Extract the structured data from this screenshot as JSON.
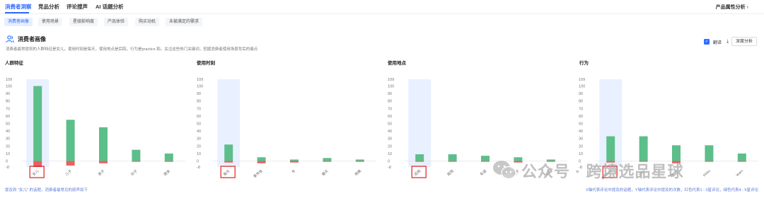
{
  "nav": {
    "tabs": [
      "消费者洞察",
      "竞品分析",
      "评论搜声",
      "AI 话题分析"
    ],
    "right_label": "产品属性分析"
  },
  "subtabs": [
    "消费者画像",
    "使用场景",
    "星级影响度",
    "产品体验",
    "购买动机",
    "未被满足的需求"
  ],
  "section": {
    "title": "消费者画像",
    "desc": "消费者最常提到的人群特征是女儿，使用时刻是每天，使用地点是后院，行为是practice 和。关注这些热门关键词，挖掘消费者使用场景背后的痛点"
  },
  "actions": {
    "translate_label": "翻译",
    "translate_checked": true,
    "deep_label": "深度分析"
  },
  "footer": {
    "left": "提及到 \"女儿\" 的话题，消费者最常见的原声如下",
    "right": "X轴代表评论中提及的话题，Y轴代表评论中提及的次数，红色代表1 - 3星评论，绿色代表4 - 5星评论"
  },
  "watermark": {
    "text": "公众号 · 跨境选品星球",
    "logo_icon": "wechat-icon"
  },
  "colors": {
    "accent": "#2f6bff",
    "positive": "#5cbf8a",
    "negative": "#e86060",
    "highlight_box": "#e02020",
    "selected_bg": "#e9f0ff"
  },
  "chart_data": [
    {
      "type": "bar",
      "title": "人群特征",
      "stacked": true,
      "yticks": [
        -8,
        0,
        10,
        20,
        30,
        40,
        50,
        60,
        70,
        80,
        90,
        100,
        109
      ],
      "ylim": [
        -8,
        109
      ],
      "categories": [
        "女儿",
        "儿子",
        "孩子",
        "孙子",
        "朋友"
      ],
      "series": [
        {
          "values": [
            100,
            55,
            45,
            15,
            10
          ]
        },
        {
          "values": [
            -8,
            -6,
            -3,
            -1,
            -1
          ]
        }
      ],
      "selected_index": 0
    },
    {
      "type": "bar",
      "title": "使用时刻",
      "stacked": true,
      "yticks": [
        -8,
        0,
        10,
        20,
        30,
        40,
        50,
        60,
        70,
        80,
        90,
        100,
        109
      ],
      "ylim": [
        -8,
        109
      ],
      "categories": [
        "每天",
        "季节性",
        "冬",
        "春天",
        "夜晚"
      ],
      "series": [
        {
          "values": [
            22,
            5,
            2,
            4,
            2
          ]
        },
        {
          "values": [
            -2,
            -3,
            -2,
            -1,
            -1
          ]
        }
      ],
      "selected_index": 0
    },
    {
      "type": "bar",
      "title": "使用地点",
      "stacked": true,
      "yticks": [
        -8,
        0,
        10,
        20,
        30,
        40,
        50,
        60,
        70,
        80,
        90,
        100,
        109
      ],
      "ylim": [
        -8,
        109
      ],
      "categories": [
        "后院",
        "庭院",
        "车道",
        "院子",
        "公园"
      ],
      "series": [
        {
          "values": [
            9,
            9,
            7,
            5,
            2
          ]
        },
        {
          "values": [
            -1,
            -1,
            -1,
            -2,
            -1
          ]
        }
      ],
      "selected_index": 0
    },
    {
      "type": "bar",
      "title": "行为",
      "stacked": true,
      "yticks": [
        -8,
        0,
        10,
        20,
        30,
        40,
        50,
        60,
        70,
        80,
        90,
        100,
        109
      ],
      "ylim": [
        -8,
        109
      ],
      "categories": [
        "practice",
        "play",
        "game",
        "tricks",
        "learn"
      ],
      "series": [
        {
          "values": [
            33,
            33,
            21,
            21,
            10
          ]
        },
        {
          "values": [
            -2,
            -1,
            -3,
            -1,
            -1
          ]
        }
      ],
      "selected_index": 0
    }
  ]
}
